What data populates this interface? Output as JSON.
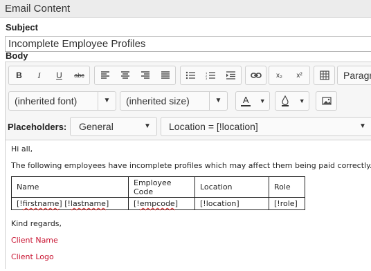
{
  "header": {
    "title": "Email Content"
  },
  "subject": {
    "label": "Subject",
    "value": "Incomplete Employee Profiles"
  },
  "body": {
    "label": "Body"
  },
  "toolbar": {
    "bold": "B",
    "italic": "I",
    "underline": "U",
    "strike": "abc",
    "sub": "x₂",
    "sup": "x²",
    "paragraph": "Paragr",
    "font": "(inherited font)",
    "size": "(inherited size)",
    "font_color_glyph": "A"
  },
  "placeholders": {
    "label": "Placeholders:",
    "category": "General",
    "value": "Location = [!location]"
  },
  "content": {
    "greeting": "Hi all,",
    "intro": "The following employees have incomplete profiles which may affect them being paid correctly.",
    "table": {
      "headers": [
        "Name",
        "Employee Code",
        "Location",
        "Role"
      ],
      "row_prefix": "[!",
      "row": {
        "name_a": "firstname",
        "name_mid": "] [!",
        "name_b": "lastname",
        "name_end": "]",
        "code_a": "[!",
        "code_b": "empcode",
        "code_end": "]",
        "location": "[!location]",
        "role": "[!role]"
      }
    },
    "signoff": "Kind regards,",
    "client_name": "Client Name",
    "client_logo": "Client Logo"
  }
}
